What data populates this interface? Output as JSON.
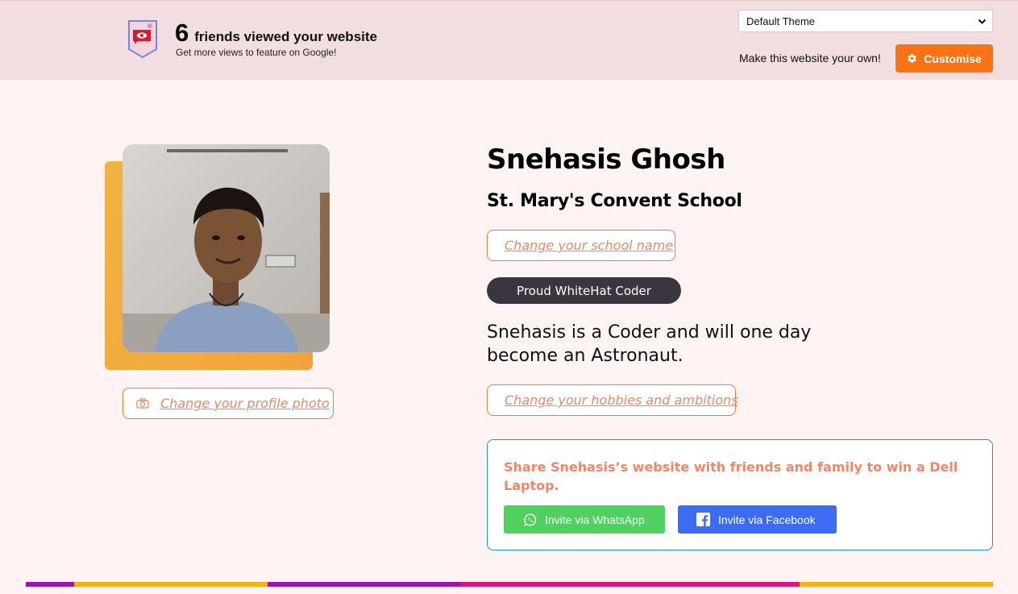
{
  "banner": {
    "views_count": "6",
    "views_text": "friends viewed your website",
    "views_subtext": "Get more views to feature on Google!",
    "badge_icon": "eye-badge-icon",
    "theme_select": {
      "selected": "Default Theme"
    },
    "make_own_text": "Make this website your own!",
    "customise_label": "Customise",
    "customise_icon": "gear-icon"
  },
  "profile": {
    "name": "Snehasis Ghosh",
    "school": "St. Mary's Convent School",
    "change_school_label": "Change your school name",
    "coder_badge": "Proud WhiteHat Coder",
    "bio": "Snehasis is a Coder and will one day become an Astronaut.",
    "change_hobbies_label": "Change your hobbies and ambitions",
    "change_photo_label": "Change your profile photo",
    "camera_icon": "camera-icon"
  },
  "share": {
    "text": "Share Snehasis’s website with friends and family to win a Dell Laptop.",
    "whatsapp_label": "Invite via WhatsApp",
    "facebook_label": "Invite via Facebook"
  },
  "colors": {
    "accent_orange": "#f97316",
    "share_text": "#f0876a",
    "whatsapp": "#4fd05f",
    "facebook": "#3c6cf4",
    "pill": "#3b3540",
    "stripe": [
      "#a012b8",
      "#f5b400",
      "#a012b8",
      "#e0128a",
      "#f5b400"
    ]
  }
}
